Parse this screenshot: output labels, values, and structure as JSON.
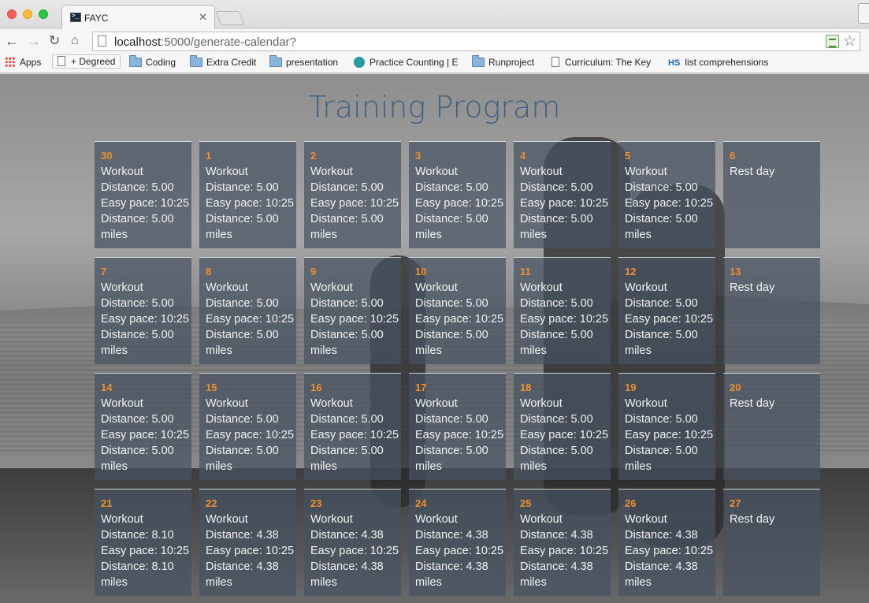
{
  "browser": {
    "tab_title": "FAYC",
    "url_host": "localhost",
    "url_path": ":5000/generate-calendar?",
    "bookmarks": [
      {
        "label": "Apps",
        "icon": "apps-grid-icon"
      },
      {
        "label": "+ Degreed",
        "icon": "page-icon"
      },
      {
        "label": "Coding",
        "icon": "folder-icon"
      },
      {
        "label": "Extra Credit",
        "icon": "folder-icon"
      },
      {
        "label": "presentation",
        "icon": "folder-icon"
      },
      {
        "label": "Practice Counting | E",
        "icon": "practice-icon"
      },
      {
        "label": "Runproject",
        "icon": "folder-icon"
      },
      {
        "label": "Curriculum: The Key",
        "icon": "page-icon"
      },
      {
        "label": "list comprehensions",
        "icon": "hs-icon",
        "prefix": "HS"
      }
    ]
  },
  "page": {
    "title": "Training Program",
    "colors": {
      "title": "#41617f",
      "day_number": "#f08f2d",
      "cell_bg": "#465262"
    }
  },
  "calendar": {
    "days": [
      {
        "day": "30",
        "lines": [
          "Workout",
          "Distance: 5.00",
          "Easy pace: 10:25",
          "Distance: 5.00",
          "miles"
        ]
      },
      {
        "day": "1",
        "lines": [
          "Workout",
          "Distance: 5.00",
          "Easy pace: 10:25",
          "Distance: 5.00",
          "miles"
        ]
      },
      {
        "day": "2",
        "lines": [
          "Workout",
          "Distance: 5.00",
          "Easy pace: 10:25",
          "Distance: 5.00",
          "miles"
        ]
      },
      {
        "day": "3",
        "lines": [
          "Workout",
          "Distance: 5.00",
          "Easy pace: 10:25",
          "Distance: 5.00",
          "miles"
        ]
      },
      {
        "day": "4",
        "lines": [
          "Workout",
          "Distance: 5.00",
          "Easy pace: 10:25",
          "Distance: 5.00",
          "miles"
        ]
      },
      {
        "day": "5",
        "lines": [
          "Workout",
          "Distance: 5.00",
          "Easy pace: 10:25",
          "Distance: 5.00",
          "miles"
        ]
      },
      {
        "day": "6",
        "lines": [
          "Rest day"
        ]
      },
      {
        "day": "7",
        "lines": [
          "Workout",
          "Distance: 5.00",
          "Easy pace: 10:25",
          "Distance: 5.00",
          "miles"
        ]
      },
      {
        "day": "8",
        "lines": [
          "Workout",
          "Distance: 5.00",
          "Easy pace: 10:25",
          "Distance: 5.00",
          "miles"
        ]
      },
      {
        "day": "9",
        "lines": [
          "Workout",
          "Distance: 5.00",
          "Easy pace: 10:25",
          "Distance: 5.00",
          "miles"
        ]
      },
      {
        "day": "10",
        "lines": [
          "Workout",
          "Distance: 5.00",
          "Easy pace: 10:25",
          "Distance: 5.00",
          "miles"
        ]
      },
      {
        "day": "11",
        "lines": [
          "Workout",
          "Distance: 5.00",
          "Easy pace: 10:25",
          "Distance: 5.00",
          "miles"
        ]
      },
      {
        "day": "12",
        "lines": [
          "Workout",
          "Distance: 5.00",
          "Easy pace: 10:25",
          "Distance: 5.00",
          "miles"
        ]
      },
      {
        "day": "13",
        "lines": [
          "Rest day"
        ]
      },
      {
        "day": "14",
        "lines": [
          "Workout",
          "Distance: 5.00",
          "Easy pace: 10:25",
          "Distance: 5.00",
          "miles"
        ]
      },
      {
        "day": "15",
        "lines": [
          "Workout",
          "Distance: 5.00",
          "Easy pace: 10:25",
          "Distance: 5.00",
          "miles"
        ]
      },
      {
        "day": "16",
        "lines": [
          "Workout",
          "Distance: 5.00",
          "Easy pace: 10:25",
          "Distance: 5.00",
          "miles"
        ]
      },
      {
        "day": "17",
        "lines": [
          "Workout",
          "Distance: 5.00",
          "Easy pace: 10:25",
          "Distance: 5.00",
          "miles"
        ]
      },
      {
        "day": "18",
        "lines": [
          "Workout",
          "Distance: 5.00",
          "Easy pace: 10:25",
          "Distance: 5.00",
          "miles"
        ]
      },
      {
        "day": "19",
        "lines": [
          "Workout",
          "Distance: 5.00",
          "Easy pace: 10:25",
          "Distance: 5.00",
          "miles"
        ]
      },
      {
        "day": "20",
        "lines": [
          "Rest day"
        ]
      },
      {
        "day": "21",
        "lines": [
          "Workout",
          "Distance: 8.10",
          "Easy pace: 10:25",
          "Distance: 8.10",
          "miles"
        ]
      },
      {
        "day": "22",
        "lines": [
          "Workout",
          "Distance: 4.38",
          "Easy pace: 10:25",
          "Distance: 4.38",
          "miles"
        ]
      },
      {
        "day": "23",
        "lines": [
          "Workout",
          "Distance: 4.38",
          "Easy pace: 10:25",
          "Distance: 4.38",
          "miles"
        ]
      },
      {
        "day": "24",
        "lines": [
          "Workout",
          "Distance: 4.38",
          "Easy pace: 10:25",
          "Distance: 4.38",
          "miles"
        ]
      },
      {
        "day": "25",
        "lines": [
          "Workout",
          "Distance: 4.38",
          "Easy pace: 10:25",
          "Distance: 4.38",
          "miles"
        ]
      },
      {
        "day": "26",
        "lines": [
          "Workout",
          "Distance: 4.38",
          "Easy pace: 10:25",
          "Distance: 4.38",
          "miles"
        ]
      },
      {
        "day": "27",
        "lines": [
          "Rest day"
        ]
      }
    ]
  }
}
